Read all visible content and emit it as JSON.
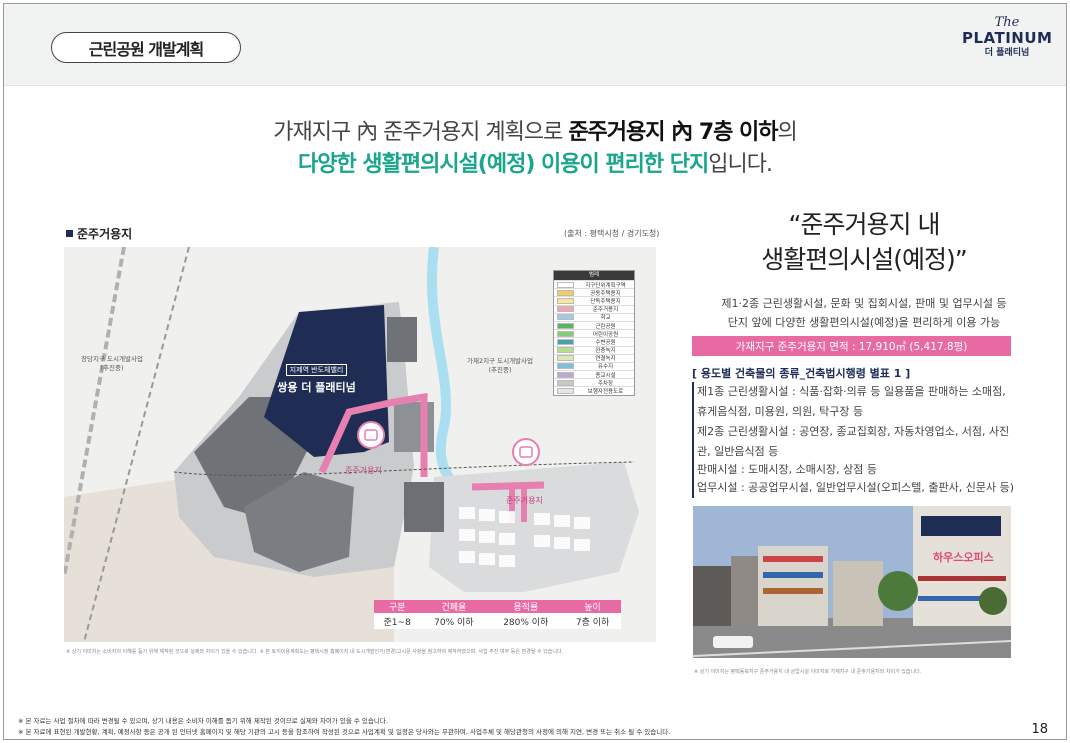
{
  "header": {
    "pill_label": "근린공원 개발계획",
    "logo": {
      "the": "The",
      "name": "PLATINUM",
      "korean": "더 플래티넘"
    }
  },
  "headline": {
    "line1_a": "가재지구 內 준주거용지 계획으로 ",
    "line1_b": "준주거용지 內 7층 이하",
    "line1_c": "의",
    "line2_a": "다양한 생활편의시설(예정) 이용이 편리한 단지",
    "line2_b": "입니다."
  },
  "map": {
    "caption": "준주거용지",
    "source": "(출처 : 평택시청 / 경기도청)",
    "district_left": "장당지구 도시개발사업\n(추진중)",
    "district_right": "가재2지구 도시개발사업\n(추진중)",
    "building_sub": "지제역 반도체밸리",
    "building_name": "쌍용 더 플래티넘",
    "pin1_label": "준주거용지",
    "pin2_label": "준주거용지",
    "legend_title": "범례",
    "legend": [
      {
        "label": "지구단위계획구역",
        "color": "#ffffff"
      },
      {
        "label": "공동주택용지",
        "color": "#f6c95a"
      },
      {
        "label": "단독주택용지",
        "color": "#f7e79e"
      },
      {
        "label": "준주거용지",
        "color": "#f0a4b4"
      },
      {
        "label": "학교",
        "color": "#a2c8e8"
      },
      {
        "label": "근린공원",
        "color": "#5ab45c"
      },
      {
        "label": "어린이공원",
        "color": "#86cc73"
      },
      {
        "label": "수변공원",
        "color": "#43a5a5"
      },
      {
        "label": "완충녹지",
        "color": "#b9dd8d"
      },
      {
        "label": "연결녹지",
        "color": "#d8eab3"
      },
      {
        "label": "유수지",
        "color": "#7ec0dc"
      },
      {
        "label": "종교시설",
        "color": "#bca7d3"
      },
      {
        "label": "주차장",
        "color": "#c8c8c8"
      },
      {
        "label": "보행자전용도로",
        "color": "#e6e6e6"
      }
    ],
    "table": {
      "headers": [
        "구분",
        "건폐율",
        "용적률",
        "높이"
      ],
      "row": [
        "준1~8",
        "70% 이하",
        "280% 이하",
        "7층 이하"
      ]
    },
    "note": "※ 상기 이미지는 소비자의 이해를 돕기 위해 제작된 것으로 실제와 차이가 있을 수 있습니다. ※ 본 토지이용계획도는 평택시청 홈페이지 내 도시개발인가(변경)고시문 사항을 참고하여 제작하였으며, 사업 추진 여부 등은 변경될 수 있습니다."
  },
  "right": {
    "quote_line1": "“준주거용지 내",
    "quote_line2": "생활편의시설(예정)”",
    "desc_line1": "제1·2종 근린생활시설, 문화 및 집회시설, 판매 및 업무시설 등",
    "desc_line2": "단지 앞에 다양한 생활편의시설(예정)을 편리하게 이용 가능",
    "area_bar": "가재지구 준주거용지 면적 : 17,910㎡ (5,417.8평)",
    "list_title": "[ 용도별 건축물의 종류_건축법시행령 별표 1 ]",
    "items": [
      "제1종 근린생활시설 : 식품·잡화·의류 등 일용품을 판매하는 소매점, 휴게음식점, 미용원, 의원, 탁구장 등",
      "제2종 근린생활시설 : 공연장, 종교집회장, 자동차영업소, 서점, 사진관, 일반음식점 등",
      "판매시설 : 도매시장, 소매시장, 상점 등",
      "업무시설 : 공공업무시설, 일반업무시설(오피스텔, 출판사, 신문사 등)"
    ],
    "photo_sign": "하우스오피스",
    "photo_note": "※ 상기 이미지는 평택동북지구 준주거용지 내 상업시설 이미지로 가재지구 내 준주거용지와 차이가 있습니다."
  },
  "footer": {
    "line1": "※ 본 자료는 사업 절차에 따라 변경될 수 있으며, 상기 내용은 소비자 이해를 돕기 위해 제작된 것이므로 실제와 차이가 있을 수 있습니다.",
    "line2": "※ 본 자료에 표현된 개발현황, 계획, 예정사항 등은 공개 된 인터넷 홈페이지 및 해당 기관의 고시 등을 참조하여 작성된 것으로 사업계획 및 일정은 당사와는 무관하며, 사업주체 및 해당관청의 사정에 의해 지연, 변경 또는 취소 될 수 있습니다.",
    "page": "18"
  }
}
